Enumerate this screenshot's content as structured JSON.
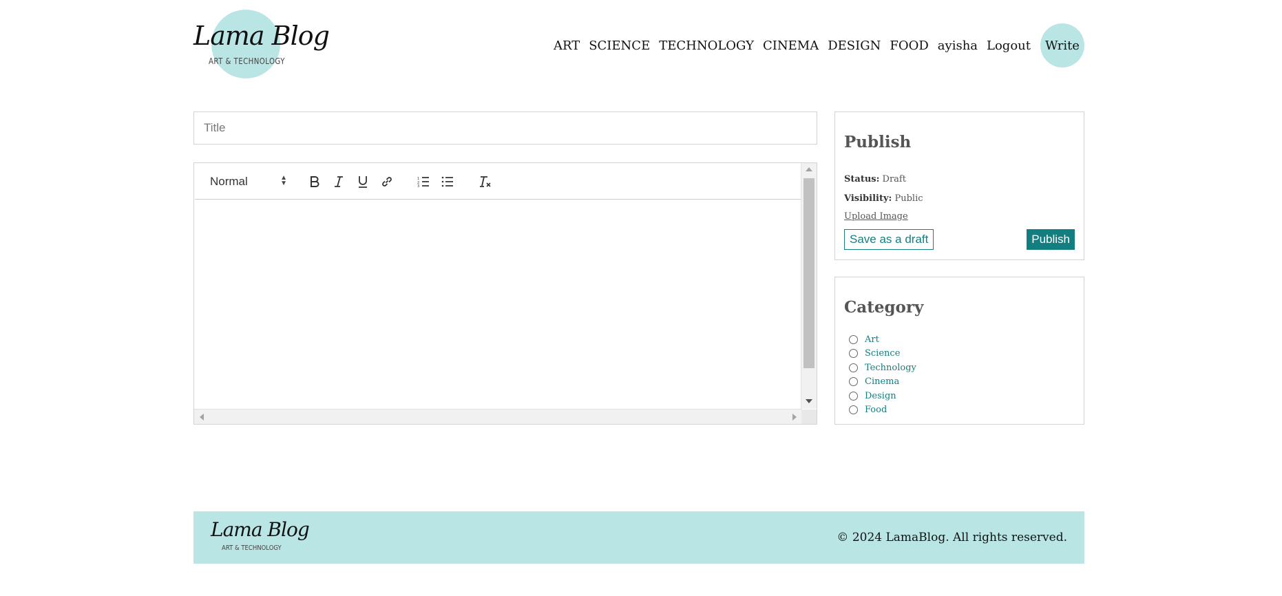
{
  "header": {
    "logo": {
      "name": "Lama Blog",
      "tagline": "ART & TECHNOLOGY"
    },
    "nav": [
      "ART",
      "SCIENCE",
      "TECHNOLOGY",
      "CINEMA",
      "DESIGN",
      "FOOD"
    ],
    "username": "ayisha",
    "logout_label": "Logout",
    "write_label": "Write"
  },
  "editor": {
    "title_placeholder": "Title",
    "format_select": "Normal",
    "toolbar_icons": [
      "bold-icon",
      "italic-icon",
      "underline-icon",
      "link-icon",
      "ordered-list-icon",
      "bullet-list-icon",
      "clear-format-icon"
    ]
  },
  "publish": {
    "heading": "Publish",
    "status_label": "Status:",
    "status_value": "Draft",
    "visibility_label": "Visibility:",
    "visibility_value": "Public",
    "upload_label": "Upload Image",
    "save_draft_label": "Save as a draft",
    "publish_label": "Publish"
  },
  "category": {
    "heading": "Category",
    "items": [
      "Art",
      "Science",
      "Technology",
      "Cinema",
      "Design",
      "Food"
    ]
  },
  "footer": {
    "logo": {
      "name": "Lama Blog",
      "tagline": "ART & TECHNOLOGY"
    },
    "copyright": "© 2024 LamaBlog. All rights reserved."
  },
  "colors": {
    "accent": "#137e80",
    "logo_circle": "#b9e5e5"
  }
}
